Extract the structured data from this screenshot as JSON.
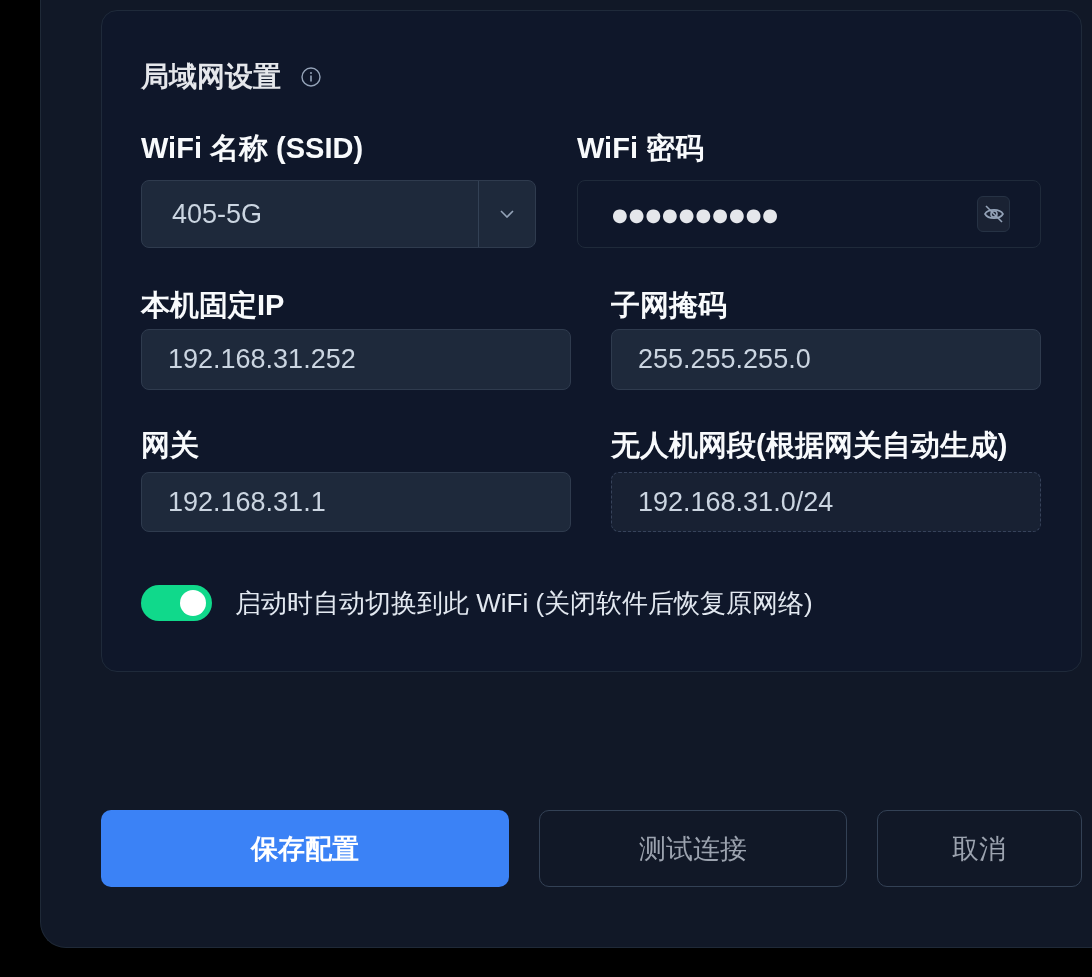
{
  "lan_settings": {
    "title": "局域网设置",
    "ssid": {
      "label": "WiFi 名称 (SSID)",
      "value": "405-5G"
    },
    "password": {
      "label": "WiFi 密码",
      "value": "●●●●●●●●●●",
      "visible": false
    },
    "fields": [
      {
        "label": "本机固定IP",
        "value": "192.168.31.252",
        "readonly": false
      },
      {
        "label": "子网掩码",
        "value": "255.255.255.0",
        "readonly": false
      },
      {
        "label": "网关",
        "value": "192.168.31.1",
        "readonly": false
      },
      {
        "label": "无人机网段(根据网关自动生成)",
        "value": "192.168.31.0/24",
        "readonly": true
      }
    ],
    "auto_switch": {
      "label": "启动时自动切换到此 WiFi (关闭软件后恢复原网络)",
      "on": true
    }
  },
  "buttons": [
    {
      "label": "保存配置",
      "kind": "primary"
    },
    {
      "label": "测试连接",
      "kind": "outline"
    },
    {
      "label": "取消",
      "kind": "outline"
    }
  ]
}
